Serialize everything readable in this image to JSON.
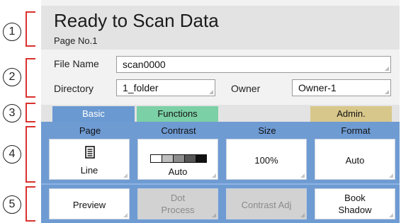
{
  "callouts": [
    "1",
    "2",
    "3",
    "4",
    "5"
  ],
  "header": {
    "title": "Ready to Scan Data",
    "subtitle": "Page No.1"
  },
  "info": {
    "file_name_label": "File Name",
    "file_name_value": "scan0000",
    "directory_label": "Directory",
    "directory_value": "1_folder",
    "owner_label": "Owner",
    "owner_value": "Owner-1"
  },
  "tabs": [
    {
      "label": "Basic",
      "active": true
    },
    {
      "label": "Functions",
      "active": false
    },
    {
      "label": "Admin.",
      "active": false
    }
  ],
  "settings": [
    {
      "header": "Page",
      "value": "Line",
      "icon": "page-icon"
    },
    {
      "header": "Contrast",
      "value": "Auto",
      "icon": "contrast-scale-icon"
    },
    {
      "header": "Size",
      "value": "100%"
    },
    {
      "header": "Format",
      "value": "Auto"
    }
  ],
  "actions": [
    {
      "line1": "Preview",
      "line2": "",
      "enabled": true
    },
    {
      "line1": "Dot",
      "line2": "Process",
      "enabled": false
    },
    {
      "line1": "Contrast Adj",
      "line2": "",
      "enabled": false
    },
    {
      "line1": "Book",
      "line2": "Shadow",
      "enabled": true
    }
  ],
  "colors": {
    "accent_blue": "#6f9bd3",
    "tab_basic": "#6a99d1",
    "tab_functions": "#7cd0a6",
    "tab_admin": "#d8c78a",
    "callout_bracket": "#d9322e"
  }
}
